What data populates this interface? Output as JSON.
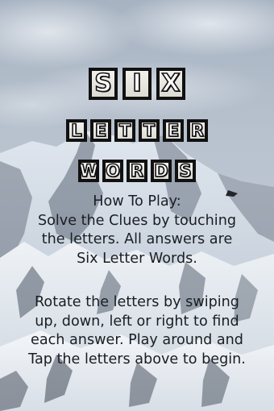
{
  "title": {
    "rows": [
      [
        "S",
        "I",
        "X"
      ],
      [
        "L",
        "E",
        "T",
        "T",
        "E",
        "R"
      ],
      [
        "W",
        "O",
        "R",
        "D",
        "S"
      ]
    ]
  },
  "instructions": {
    "paragraph1": [
      "How To Play:",
      "Solve the Clues by touching",
      "the letters. All answers are",
      "Six Letter Words."
    ],
    "paragraph2": [
      "Rotate the letters by swiping",
      "up, down, left or right to find",
      "each answer. Play around and",
      "Tap the letters above to begin."
    ]
  },
  "colors": {
    "sky": "#a9b6c6",
    "snow": "#e6ebf0",
    "rock": "#4a5462",
    "text": "#1a1e23",
    "tile_border": "#111111"
  }
}
